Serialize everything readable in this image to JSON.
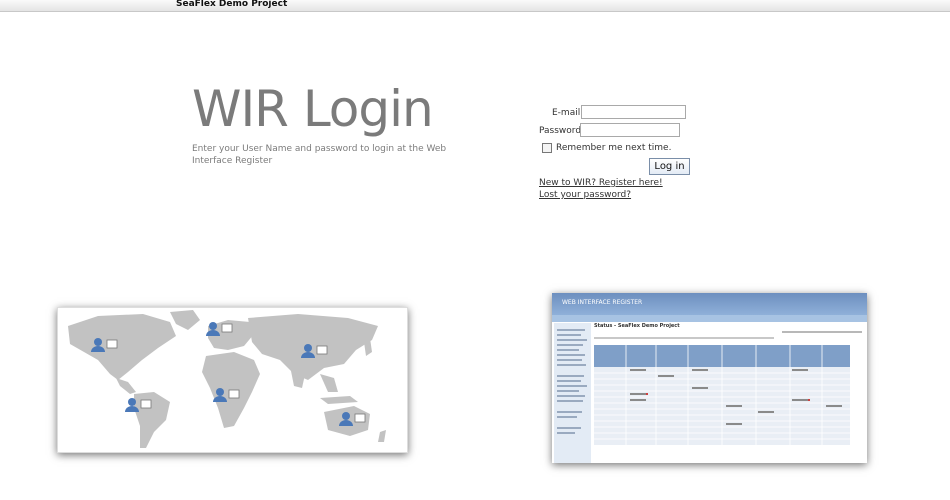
{
  "app": {
    "project_title": "SeaFlex Demo Project"
  },
  "login": {
    "heading": "WIR Login",
    "intro": "Enter your User Name and password to login at the Web Interface Register",
    "email_label": "E-mail:",
    "email_value": "",
    "password_label": "Password:",
    "password_value": "",
    "remember_label": "Remember me next time.",
    "remember_checked": false,
    "login_button": "Log in",
    "register_link": "New to WIR? Register here!",
    "lost_password_link": "Lost your password?"
  },
  "preview": {
    "header_title": "WEB INTERFACE REGISTER",
    "page_title": "Status - SeaFlex Demo Project"
  },
  "colors": {
    "heading": "#7b7b7b",
    "preview_header": "#6d8fbf",
    "map_land": "#c2c2c2",
    "user_icon": "#4a78b8"
  }
}
